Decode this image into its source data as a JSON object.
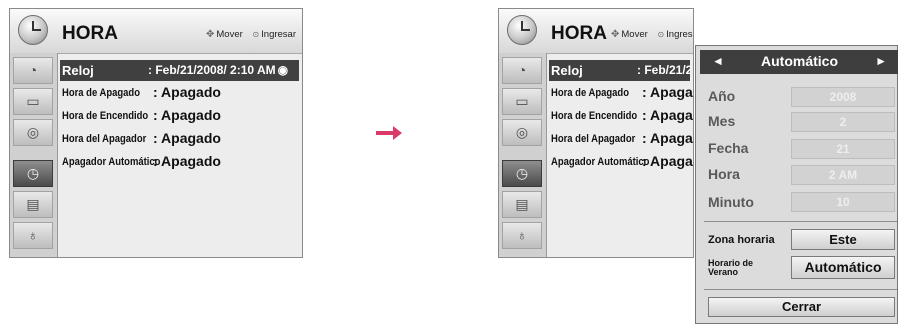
{
  "header": {
    "title": "HORA",
    "move_label": "Mover",
    "enter_label": "Ingresar"
  },
  "left_menu": [
    {
      "label": "Reloj",
      "value": ": Feb/21/2008/  2:10 AM"
    },
    {
      "label": "Hora de Apagado",
      "value": ": Apagado"
    },
    {
      "label": "Hora de Encendido",
      "value": ": Apagado"
    },
    {
      "label": "Hora del Apagador",
      "value": ": Apagado"
    },
    {
      "label": "Apagador Automático",
      "value": ": Apagado"
    }
  ],
  "right_menu": [
    {
      "label": "Reloj",
      "value": ": Feb/21/2"
    },
    {
      "label": "Hora de Apagado",
      "value": ": Apaga"
    },
    {
      "label": "Hora de Encendido",
      "value": ": Apaga"
    },
    {
      "label": "Hora del Apagador",
      "value": ": Apaga"
    },
    {
      "label": "Apagador Automático",
      "value": ": Apaga"
    }
  ],
  "sidebar_icons": [
    "satellite-dish-icon",
    "tv-picture-icon",
    "speaker-icon",
    "clock-icon",
    "lock-icon",
    "input-plug-icon"
  ],
  "popup": {
    "mode": "Automático",
    "fields": [
      {
        "label": "Año",
        "value": "2008"
      },
      {
        "label": "Mes",
        "value": "2"
      },
      {
        "label": "Fecha",
        "value": "21"
      },
      {
        "label": "Hora",
        "value": "2 AM"
      },
      {
        "label": "Minuto",
        "value": "10"
      }
    ],
    "timezone_label": "Zona horaria",
    "timezone_value": "Este",
    "dst_label_line1": "Horario de",
    "dst_label_line2": "Verano",
    "dst_value": "Automático",
    "close_label": "Cerrar"
  },
  "colors": {
    "arrow": "#d93a6a",
    "selection": "#404040"
  }
}
